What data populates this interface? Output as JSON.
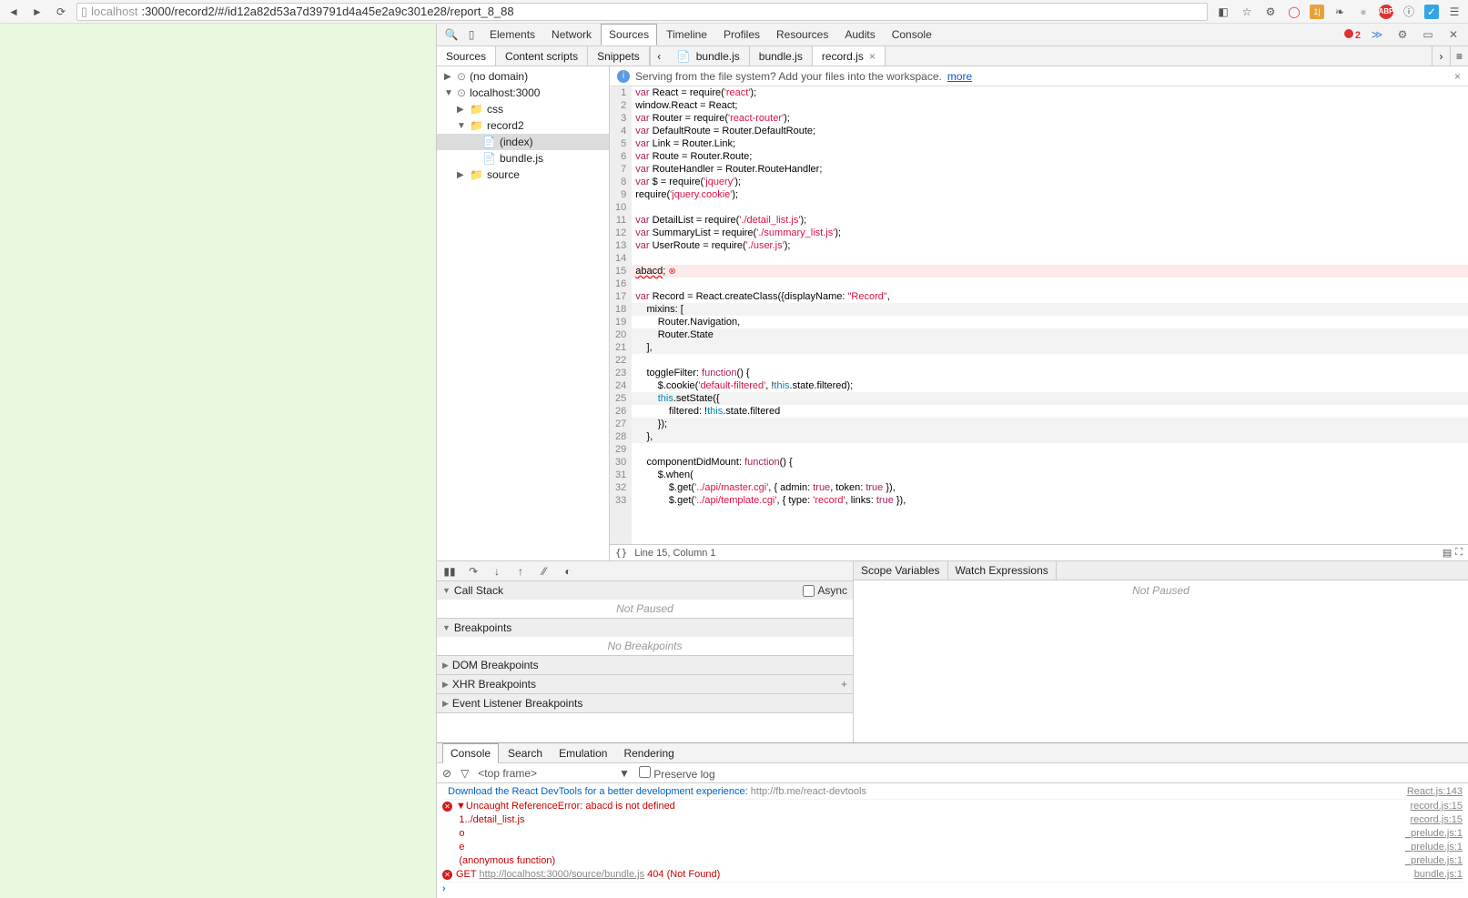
{
  "browser": {
    "url_prefix": "localhost",
    "url_rest": ":3000/record2/#/id12a82d53a7d39791d4a45e2a9c301e28/report_8_88"
  },
  "devtools": {
    "tabs": [
      "Elements",
      "Network",
      "Sources",
      "Timeline",
      "Profiles",
      "Resources",
      "Audits",
      "Console"
    ],
    "activeTab": "Sources",
    "errorCount": "2"
  },
  "sources": {
    "subtabs": [
      "Sources",
      "Content scripts",
      "Snippets"
    ],
    "activeSubtab": "Sources",
    "fileTabs": [
      {
        "name": "bundle.js",
        "active": false,
        "closable": false
      },
      {
        "name": "bundle.js",
        "active": false,
        "closable": false
      },
      {
        "name": "record.js",
        "active": true,
        "closable": true
      }
    ],
    "nav": [
      {
        "label": "(no domain)",
        "indent": 0,
        "arrow": "▶",
        "icon": "cloud"
      },
      {
        "label": "localhost:3000",
        "indent": 0,
        "arrow": "▼",
        "icon": "cloud"
      },
      {
        "label": "css",
        "indent": 1,
        "arrow": "▶",
        "icon": "folder"
      },
      {
        "label": "record2",
        "indent": 1,
        "arrow": "▼",
        "icon": "folder"
      },
      {
        "label": "(index)",
        "indent": 2,
        "arrow": "",
        "icon": "file",
        "selected": true
      },
      {
        "label": "bundle.js",
        "indent": 2,
        "arrow": "",
        "icon": "file"
      },
      {
        "label": "source",
        "indent": 1,
        "arrow": "▶",
        "icon": "folder"
      }
    ],
    "notice": {
      "text": "Serving from the file system? Add your files into the workspace.",
      "link": "more"
    }
  },
  "code": {
    "lines": [
      {
        "n": 1,
        "html": "<span class='kw'>var</span> React = require(<span class='str'>'react'</span>);"
      },
      {
        "n": 2,
        "html": "window.React = React;"
      },
      {
        "n": 3,
        "html": "<span class='kw'>var</span> Router = require(<span class='str'>'react-router'</span>);"
      },
      {
        "n": 4,
        "html": "<span class='kw'>var</span> DefaultRoute = Router.DefaultRoute;"
      },
      {
        "n": 5,
        "html": "<span class='kw'>var</span> Link = Router.Link;"
      },
      {
        "n": 6,
        "html": "<span class='kw'>var</span> Route = Router.Route;"
      },
      {
        "n": 7,
        "html": "<span class='kw'>var</span> RouteHandler = Router.RouteHandler;"
      },
      {
        "n": 8,
        "html": "<span class='kw'>var</span> $ = require(<span class='str'>'jquery'</span>);"
      },
      {
        "n": 9,
        "html": "require(<span class='str'>'jquery.cookie'</span>);"
      },
      {
        "n": 10,
        "html": ""
      },
      {
        "n": 11,
        "html": "<span class='kw'>var</span> DetailList = require(<span class='str'>'./detail_list.js'</span>);"
      },
      {
        "n": 12,
        "html": "<span class='kw'>var</span> SummaryList = require(<span class='str'>'./summary_list.js'</span>);"
      },
      {
        "n": 13,
        "html": "<span class='kw'>var</span> UserRoute = require(<span class='str'>'./user.js'</span>);"
      },
      {
        "n": 14,
        "html": ""
      },
      {
        "n": 15,
        "html": "<span style='text-decoration: wavy underline red'>abacd</span>; <span class='err-ic'>⊗</span>",
        "error": true
      },
      {
        "n": 16,
        "html": ""
      },
      {
        "n": 17,
        "html": "<span class='kw'>var</span> Record = React.createClass({displayName: <span class='str'>\"Record\"</span>,"
      },
      {
        "n": 18,
        "html": "    mixins: [",
        "odd": true
      },
      {
        "n": 19,
        "html": "        Router.Navigation,"
      },
      {
        "n": 20,
        "html": "        Router.State",
        "odd": true
      },
      {
        "n": 21,
        "html": "    ],",
        "odd": true
      },
      {
        "n": 22,
        "html": ""
      },
      {
        "n": 23,
        "html": "    toggleFilter: <span class='fn'>function</span>() {"
      },
      {
        "n": 24,
        "html": "        $.cookie(<span class='str'>'default-filtered'</span>, !<span class='this'>this</span>.state.filtered);"
      },
      {
        "n": 25,
        "html": "        <span class='this'>this</span>.setState({",
        "odd": true
      },
      {
        "n": 26,
        "html": "            filtered: !<span class='this'>this</span>.state.filtered"
      },
      {
        "n": 27,
        "html": "        });",
        "odd": true
      },
      {
        "n": 28,
        "html": "    },",
        "odd": true
      },
      {
        "n": 29,
        "html": ""
      },
      {
        "n": 30,
        "html": "    componentDidMount: <span class='fn'>function</span>() {"
      },
      {
        "n": 31,
        "html": "        $.when("
      },
      {
        "n": 32,
        "html": "            $.get(<span class='str'>'../api/master.cgi'</span>, { admin: <span class='lit'>true</span>, token: <span class='lit'>true</span> }),"
      },
      {
        "n": 33,
        "html": "            $.get(<span class='str'>'../api/template.cgi'</span>, { type: <span class='str'>'record'</span>, links: <span class='lit'>true</span> }),"
      }
    ]
  },
  "status": {
    "pos": "Line 15, Column 1"
  },
  "debugger": {
    "sections": {
      "callstack": {
        "title": "Call Stack",
        "body": "Not Paused",
        "async": "Async"
      },
      "breakpoints": {
        "title": "Breakpoints",
        "body": "No Breakpoints"
      },
      "dom": {
        "title": "DOM Breakpoints"
      },
      "xhr": {
        "title": "XHR Breakpoints"
      },
      "evt": {
        "title": "Event Listener Breakpoints"
      }
    },
    "right": {
      "scope": "Scope Variables",
      "watch": "Watch Expressions",
      "body": "Not Paused"
    }
  },
  "console": {
    "tabs": [
      "Console",
      "Search",
      "Emulation",
      "Rendering"
    ],
    "activeTab": "Console",
    "frame": "<top frame>",
    "preserve": "Preserve log",
    "rows": [
      {
        "type": "info",
        "blue": "Download the React DevTools for a better development experience: ",
        "gray": "http://fb.me/react-devtools",
        "src": "React.js:143"
      },
      {
        "type": "error-head",
        "text": "▼Uncaught ReferenceError: abacd is not defined",
        "src": "record.js:15"
      },
      {
        "type": "error-line",
        "text": "1../detail_list.js",
        "src": "record.js:15"
      },
      {
        "type": "error-line",
        "text": "o",
        "src": "_prelude.js:1"
      },
      {
        "type": "error-line",
        "text": "e",
        "src": "_prelude.js:1"
      },
      {
        "type": "error-line",
        "text": "(anonymous function)",
        "src": "_prelude.js:1"
      },
      {
        "type": "get-error",
        "method": "GET ",
        "url": "http://localhost:3000/source/bundle.js",
        "status": " 404 (Not Found)",
        "src": "bundle.js:1"
      }
    ]
  }
}
